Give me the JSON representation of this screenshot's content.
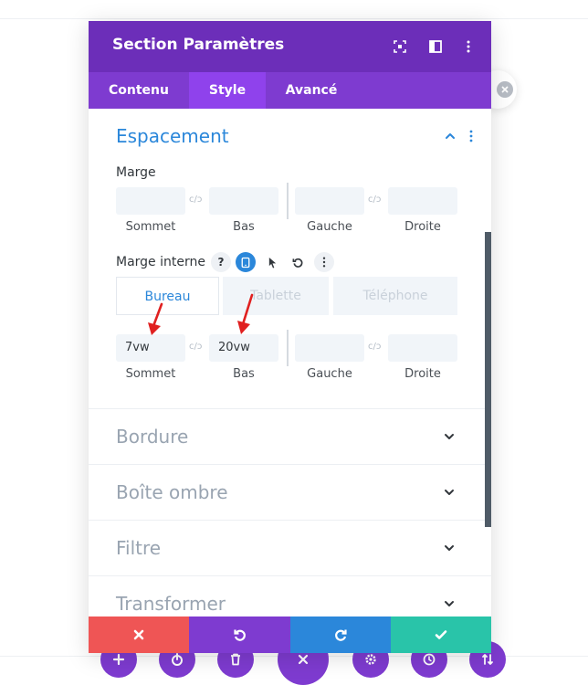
{
  "modal": {
    "title": "Section Paramètres",
    "tabs": [
      {
        "label": "Contenu"
      },
      {
        "label": "Style",
        "active": true
      },
      {
        "label": "Avancé"
      }
    ]
  },
  "spacing": {
    "title": "Espacement",
    "margin": {
      "label": "Marge",
      "fields": [
        {
          "label": "Sommet",
          "value": ""
        },
        {
          "label": "Bas",
          "value": ""
        },
        {
          "label": "Gauche",
          "value": ""
        },
        {
          "label": "Droite",
          "value": ""
        }
      ],
      "link_glyph": "c/ɔ"
    },
    "padding": {
      "label": "Marge interne",
      "help_glyph": "?",
      "device_tabs": [
        {
          "label": "Bureau",
          "active": true
        },
        {
          "label": "Tablette"
        },
        {
          "label": "Téléphone"
        }
      ],
      "fields": [
        {
          "label": "Sommet",
          "value": "7vw"
        },
        {
          "label": "Bas",
          "value": "20vw"
        },
        {
          "label": "Gauche",
          "value": ""
        },
        {
          "label": "Droite",
          "value": ""
        }
      ]
    }
  },
  "sections": [
    {
      "title": "Bordure"
    },
    {
      "title": "Boîte ombre"
    },
    {
      "title": "Filtre"
    },
    {
      "title": "Transformer"
    }
  ],
  "colors": {
    "header": "#6c2eb9",
    "tabs": "#7e3bd0",
    "tab_active": "#8f42ec",
    "accent_blue": "#2b87da",
    "cancel": "#ef5555",
    "undo": "#7e3bd0",
    "redo": "#2b87da",
    "save": "#29c4a9"
  },
  "icons": {
    "header": [
      "expand-icon",
      "columns-icon",
      "kebab-icon"
    ],
    "footer": [
      "close-icon",
      "undo-icon",
      "redo-icon",
      "check-icon"
    ],
    "builder_bar": [
      "plus-icon",
      "power-icon",
      "trash-icon",
      "close-icon",
      "gear-icon",
      "history-icon",
      "sort-icon"
    ]
  }
}
